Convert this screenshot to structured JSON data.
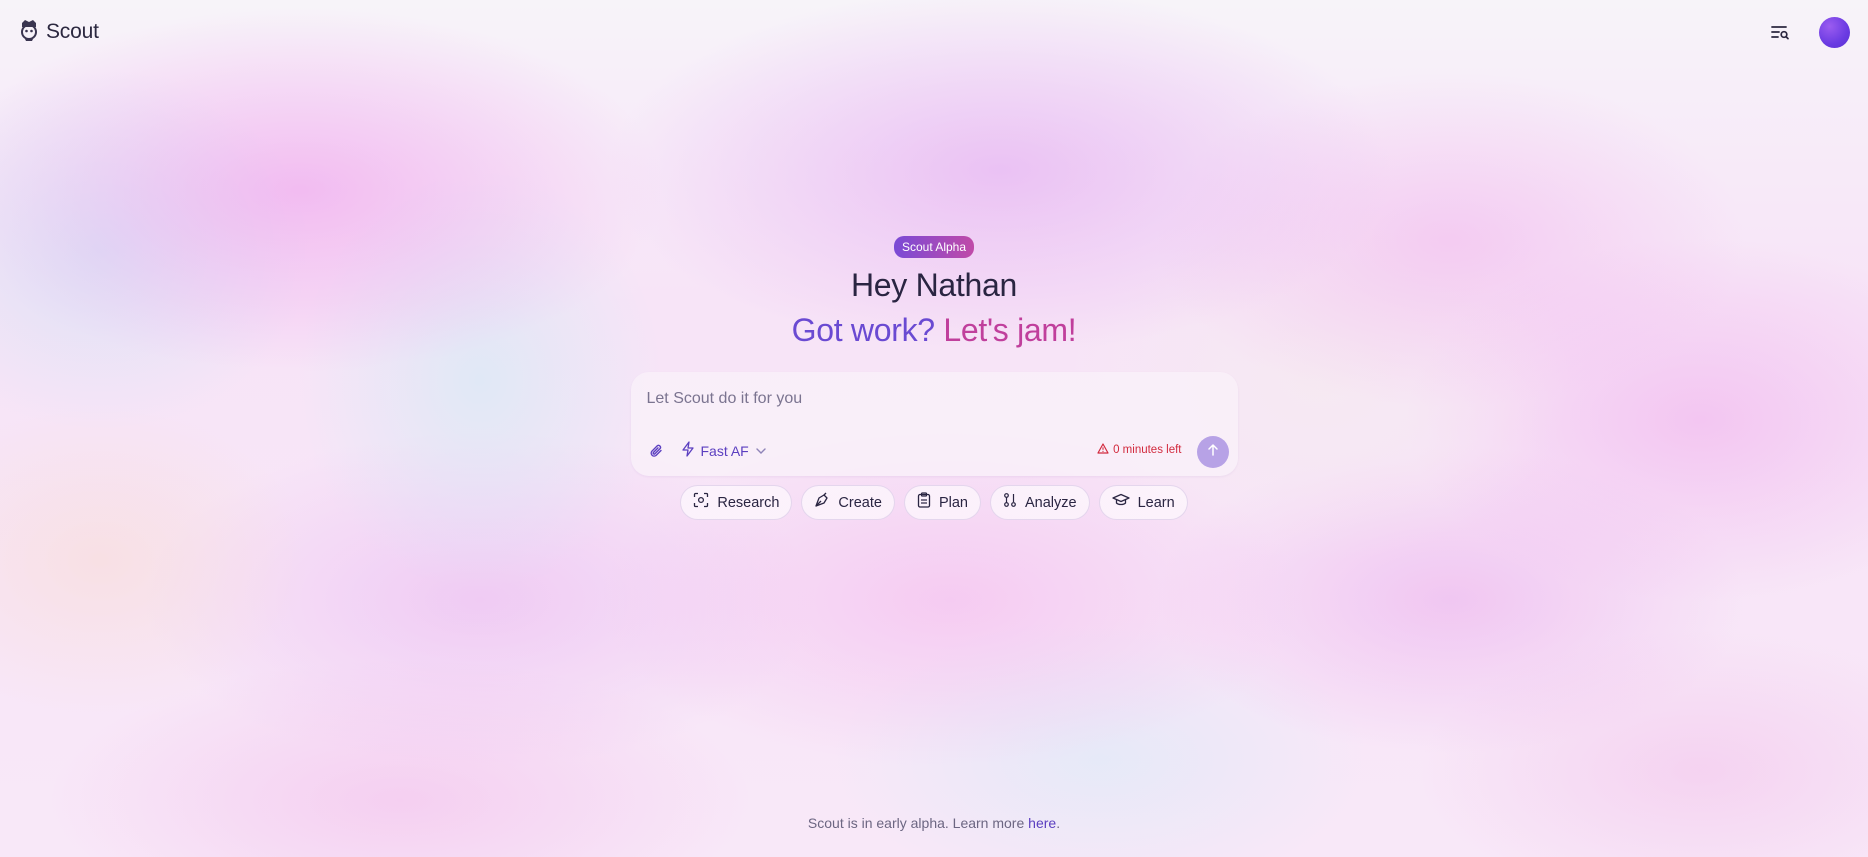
{
  "brand": {
    "name": "Scout",
    "icon": "scout-logo-icon"
  },
  "topbar": {
    "history_icon": "search-history-icon",
    "avatar_color": "#6a3be2"
  },
  "hero": {
    "badge": "Scout Alpha",
    "greeting": "Hey Nathan",
    "tagline_part1": "Got work? ",
    "tagline_part2": "Let's jam!"
  },
  "composer": {
    "placeholder": "Let Scout do it for you",
    "value": "",
    "model_label": "Fast AF",
    "limit_text": "0 minutes left",
    "send_icon": "arrow-up-icon"
  },
  "chips": [
    {
      "label": "Research",
      "icon": "scan-icon"
    },
    {
      "label": "Create",
      "icon": "pen-tool-icon"
    },
    {
      "label": "Plan",
      "icon": "clipboard-icon"
    },
    {
      "label": "Analyze",
      "icon": "chart-nodes-icon"
    },
    {
      "label": "Learn",
      "icon": "graduation-cap-icon"
    }
  ],
  "footer": {
    "text": "Scout is in early alpha. Learn more ",
    "link": "here",
    "after": "."
  },
  "colors": {
    "accent": "#5b3fc0",
    "warning": "#d22a3e",
    "send": "#b7a2e6"
  }
}
